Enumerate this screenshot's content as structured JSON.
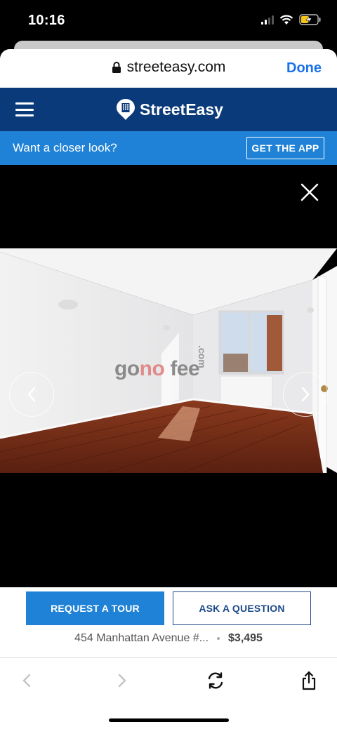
{
  "status_bar": {
    "time": "10:16",
    "signal_icon": "cellular-signal-icon",
    "wifi_icon": "wifi-icon",
    "battery_icon": "battery-charging-icon"
  },
  "browser": {
    "url": "streeteasy.com",
    "done_label": "Done",
    "lock_icon": "lock-icon"
  },
  "header": {
    "brand_name": "StreetEasy",
    "menu_icon": "hamburger-menu-icon",
    "logo_icon": "building-pin-icon",
    "brand_color": "#0b3a7a"
  },
  "promo": {
    "text": "Want a closer look?",
    "button_label": "GET THE APP",
    "color": "#1f82d6"
  },
  "gallery": {
    "watermark": {
      "part1": "go",
      "part2": "no",
      "part3": "fee",
      "suffix": ".com"
    },
    "close_icon": "close-icon",
    "prev_icon": "chevron-left-icon",
    "next_icon": "chevron-right-icon"
  },
  "actions": {
    "request_tour_label": "REQUEST A TOUR",
    "ask_question_label": "ASK A QUESTION",
    "address": "454 Manhattan Avenue #...",
    "price": "$3,495"
  },
  "toolbar": {
    "back_icon": "back-arrow-icon",
    "forward_icon": "forward-arrow-icon",
    "reload_icon": "reload-icon",
    "share_icon": "share-icon"
  }
}
